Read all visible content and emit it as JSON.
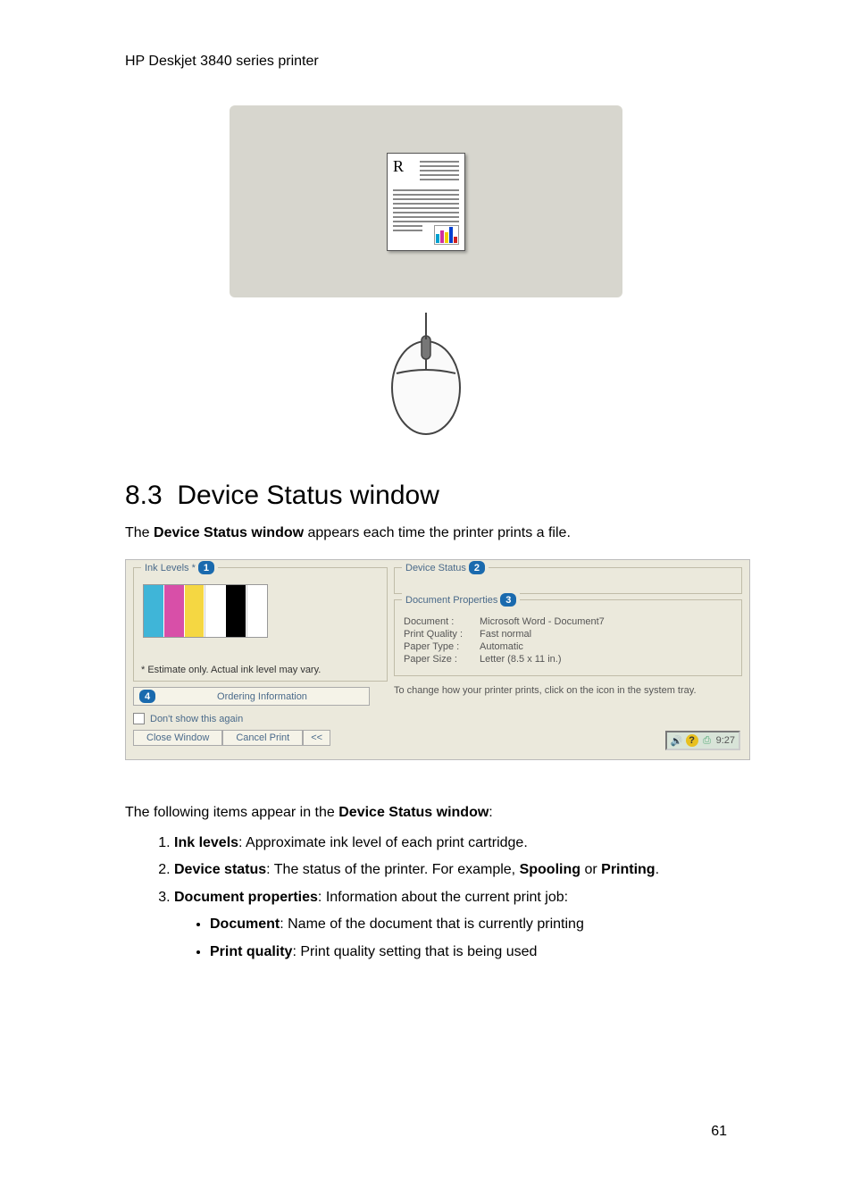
{
  "header": "HP Deskjet 3840 series printer",
  "section": {
    "number": "8.3",
    "title": "Device Status window"
  },
  "intro": {
    "prefix": "The ",
    "bold": "Device Status window",
    "suffix": " appears each time the printer prints a file."
  },
  "dialog": {
    "ink_levels_label": "Ink Levels *",
    "callout1": "1",
    "estimate_note": "* Estimate only.  Actual ink level may vary.",
    "ordering_callout": "4",
    "ordering_label": "Ordering Information",
    "dont_show": "Don't show this again",
    "close_window": "Close Window",
    "cancel_print": "Cancel Print",
    "collapse": "<<",
    "device_status_label": "Device Status",
    "callout2": "2",
    "doc_props_label": "Document Properties",
    "callout3": "3",
    "props": {
      "document_label": "Document :",
      "document_value": "Microsoft Word - Document7",
      "print_quality_label": "Print Quality :",
      "print_quality_value": "Fast normal",
      "paper_type_label": "Paper Type :",
      "paper_type_value": "Automatic",
      "paper_size_label": "Paper Size :",
      "paper_size_value": "Letter (8.5 x 11 in.)"
    },
    "change_hint": "To change how your printer prints, click on the icon in the system tray.",
    "tray_time": "9:27"
  },
  "following_text_prefix": "The following items appear in the ",
  "following_text_bold": "Device Status window",
  "following_text_suffix": ":",
  "list": {
    "item1_bold": "Ink levels",
    "item1_rest": ": Approximate ink level of each print cartridge.",
    "item2_bold": "Device status",
    "item2_rest_a": ": The status of the printer. For example, ",
    "item2_bold_b": "Spooling",
    "item2_rest_c": " or ",
    "item2_bold_d": "Printing",
    "item2_rest_e": ".",
    "item3_bold": "Document properties",
    "item3_rest": ": Information about the current print job:",
    "sub1_bold": "Document",
    "sub1_rest": ": Name of the document that is currently printing",
    "sub2_bold": "Print quality",
    "sub2_rest": ": Print quality setting that is being used"
  },
  "page_number": "61",
  "preview_r": "R"
}
